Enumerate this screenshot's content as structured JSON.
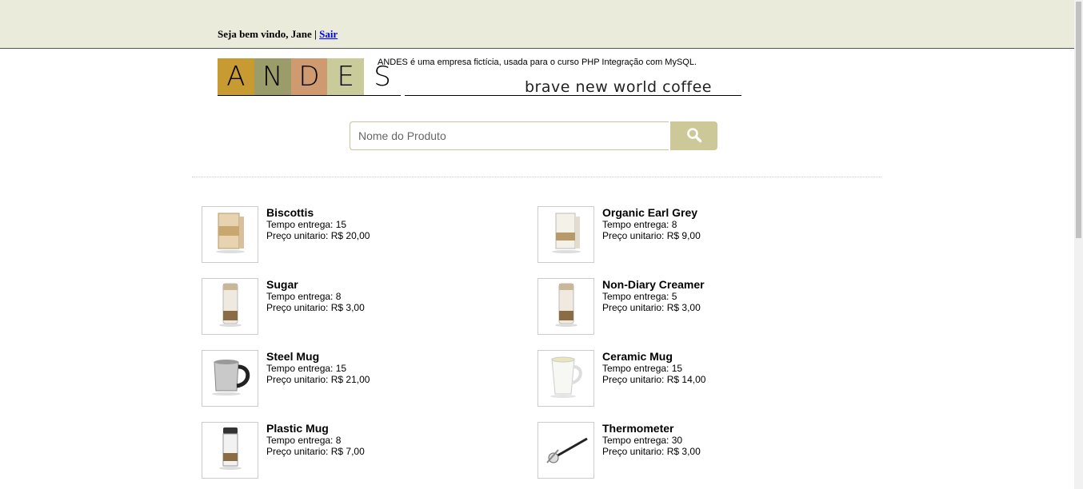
{
  "header": {
    "welcome_text": "Seja bem vindo, Jane | ",
    "logout_label": "Sair"
  },
  "logo": {
    "letters": [
      "A",
      "N",
      "D",
      "E",
      "S"
    ],
    "tile_colors": [
      "#c79a32",
      "#9a9c6a",
      "#d09a70",
      "#c9cb9a",
      "#ffffff"
    ],
    "tagline": "brave new world coffee"
  },
  "description": "ANDES é uma empresa fictícia, usada para o curso PHP Integração com MySQL.",
  "search": {
    "placeholder": "Nome do Produto",
    "button_icon": "search-icon"
  },
  "labels": {
    "delivery": "Tempo entrega: ",
    "price": "Preço unitario: R$ "
  },
  "products": [
    {
      "name": "Biscottis",
      "delivery": "15",
      "price": "20,00",
      "icon": "biscotti-box-icon"
    },
    {
      "name": "Organic Earl Grey",
      "delivery": "8",
      "price": "9,00",
      "icon": "tea-box-icon"
    },
    {
      "name": "Sugar",
      "delivery": "8",
      "price": "3,00",
      "icon": "canister-icon"
    },
    {
      "name": "Non-Diary Creamer",
      "delivery": "5",
      "price": "3,00",
      "icon": "canister-icon"
    },
    {
      "name": "Steel Mug",
      "delivery": "15",
      "price": "21,00",
      "icon": "steel-mug-icon"
    },
    {
      "name": "Ceramic Mug",
      "delivery": "15",
      "price": "14,00",
      "icon": "ceramic-mug-icon"
    },
    {
      "name": "Plastic Mug",
      "delivery": "8",
      "price": "7,00",
      "icon": "travel-mug-icon"
    },
    {
      "name": "Thermometer",
      "delivery": "30",
      "price": "3,00",
      "icon": "thermometer-icon"
    }
  ]
}
